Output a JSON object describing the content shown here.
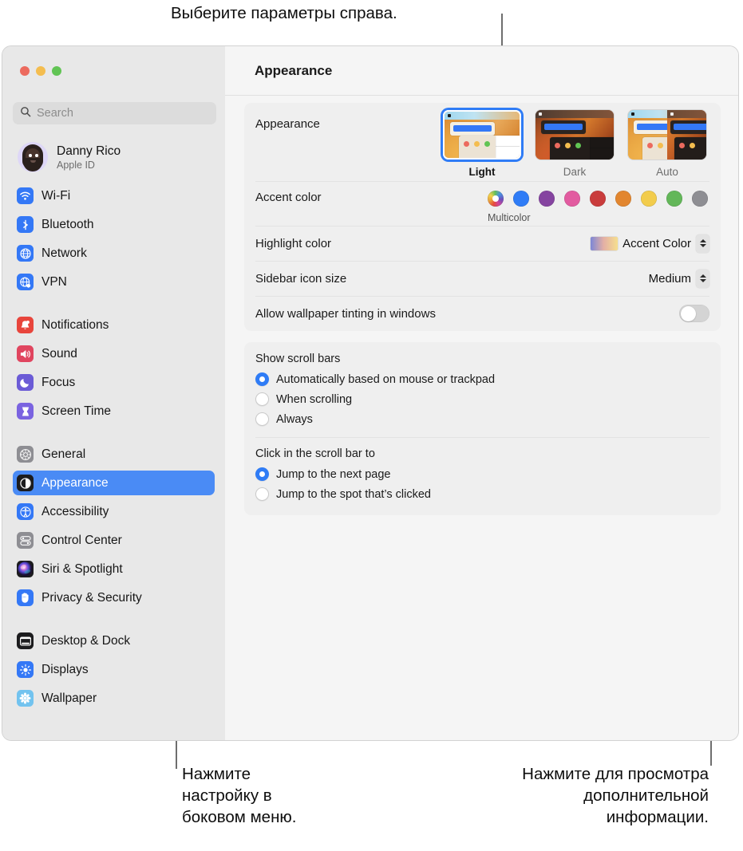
{
  "callouts": {
    "top": "Выберите параметры справа.",
    "bottom_left": "Нажмите\nнастройку в\nбоковом меню.",
    "bottom_right": "Нажмите для просмотра\nдополнительной\nинформации."
  },
  "window": {
    "traffic_lights": [
      "close",
      "minimize",
      "zoom"
    ],
    "title": "Appearance"
  },
  "sidebar": {
    "search": {
      "placeholder": "Search",
      "value": ""
    },
    "account": {
      "name": "Danny Rico",
      "subtitle": "Apple ID"
    },
    "groups": [
      {
        "items": [
          {
            "label": "Wi-Fi",
            "icon": "wifi-icon",
            "color": "#3478f6",
            "selected": false
          },
          {
            "label": "Bluetooth",
            "icon": "bluetooth-icon",
            "color": "#3478f6",
            "selected": false
          },
          {
            "label": "Network",
            "icon": "globe-icon",
            "color": "#3478f6",
            "selected": false
          },
          {
            "label": "VPN",
            "icon": "globe-shield-icon",
            "color": "#3478f6",
            "selected": false
          }
        ]
      },
      {
        "items": [
          {
            "label": "Notifications",
            "icon": "bell-icon",
            "color": "#e8453c",
            "selected": false
          },
          {
            "label": "Sound",
            "icon": "speaker-icon",
            "color": "#e0455f",
            "selected": false
          },
          {
            "label": "Focus",
            "icon": "moon-icon",
            "color": "#6b5bd6",
            "selected": false
          },
          {
            "label": "Screen Time",
            "icon": "hourglass-icon",
            "color": "#7a63e0",
            "selected": false
          }
        ]
      },
      {
        "items": [
          {
            "label": "General",
            "icon": "gear-icon",
            "color": "#8e8e93",
            "selected": false
          },
          {
            "label": "Appearance",
            "icon": "appearance-icon",
            "color": "#1c1c1e",
            "selected": true
          },
          {
            "label": "Accessibility",
            "icon": "accessibility-icon",
            "color": "#3478f6",
            "selected": false
          },
          {
            "label": "Control Center",
            "icon": "control-center-icon",
            "color": "#8e8e93",
            "selected": false
          },
          {
            "label": "Siri & Spotlight",
            "icon": "siri-icon",
            "color": "#1c1c1e",
            "selected": false
          },
          {
            "label": "Privacy & Security",
            "icon": "hand-icon",
            "color": "#3478f6",
            "selected": false
          }
        ]
      },
      {
        "items": [
          {
            "label": "Desktop & Dock",
            "icon": "desktop-dock-icon",
            "color": "#1c1c1e",
            "selected": false
          },
          {
            "label": "Displays",
            "icon": "brightness-icon",
            "color": "#3478f6",
            "selected": false
          },
          {
            "label": "Wallpaper",
            "icon": "wallpaper-icon",
            "color": "#72c3ef",
            "selected": false
          }
        ]
      }
    ]
  },
  "detail": {
    "title": "Appearance",
    "appearance": {
      "label": "Appearance",
      "options": [
        {
          "name": "Light",
          "selected": true
        },
        {
          "name": "Dark",
          "selected": false
        },
        {
          "name": "Auto",
          "selected": false
        }
      ]
    },
    "accent_color": {
      "label": "Accent color",
      "selected_caption": "Multicolor",
      "swatches": [
        {
          "name": "Multicolor",
          "color": "multicolor",
          "selected": true
        },
        {
          "name": "Blue",
          "color": "#2f7cf6",
          "selected": false
        },
        {
          "name": "Purple",
          "color": "#8544a0",
          "selected": false
        },
        {
          "name": "Pink",
          "color": "#e25ba0",
          "selected": false
        },
        {
          "name": "Red",
          "color": "#c93c3c",
          "selected": false
        },
        {
          "name": "Orange",
          "color": "#e2862f",
          "selected": false
        },
        {
          "name": "Yellow",
          "color": "#f2cc4c",
          "selected": false
        },
        {
          "name": "Green",
          "color": "#63b759",
          "selected": false
        },
        {
          "name": "Graphite",
          "color": "#8e8e93",
          "selected": false
        }
      ]
    },
    "highlight_color": {
      "label": "Highlight color",
      "value": "Accent Color"
    },
    "sidebar_icon_size": {
      "label": "Sidebar icon size",
      "value": "Medium"
    },
    "wallpaper_tinting": {
      "label": "Allow wallpaper tinting in windows",
      "enabled": false
    },
    "show_scroll_bars": {
      "title": "Show scroll bars",
      "options": [
        {
          "label": "Automatically based on mouse or trackpad",
          "selected": true
        },
        {
          "label": "When scrolling",
          "selected": false
        },
        {
          "label": "Always",
          "selected": false
        }
      ]
    },
    "click_scroll_bar": {
      "title": "Click in the scroll bar to",
      "options": [
        {
          "label": "Jump to the next page",
          "selected": true
        },
        {
          "label": "Jump to the spot that’s clicked",
          "selected": false
        }
      ]
    },
    "help_button": {
      "glyph": "?"
    }
  }
}
